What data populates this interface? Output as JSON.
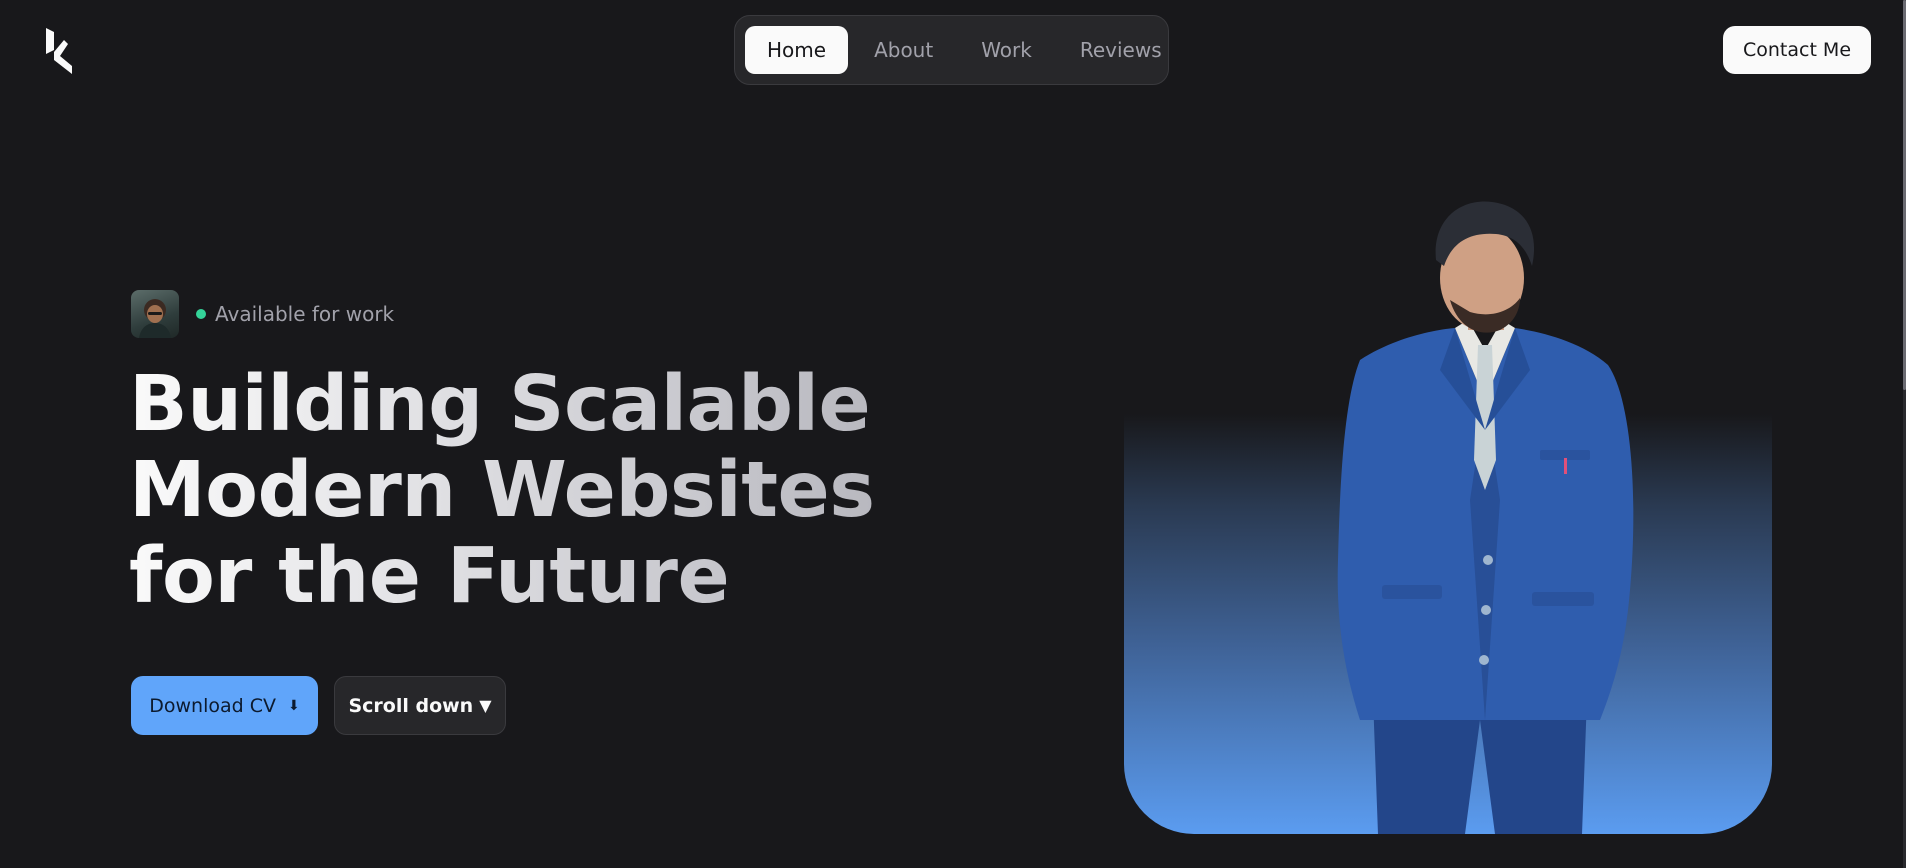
{
  "header": {
    "logo_icon": "brand-logo-icon",
    "nav": [
      {
        "label": "Home",
        "active": true
      },
      {
        "label": "About",
        "active": false
      },
      {
        "label": "Work",
        "active": false
      },
      {
        "label": "Reviews",
        "active": false
      }
    ],
    "contact_label": "Contact Me"
  },
  "hero": {
    "status_text": "Available for work",
    "status_color": "#34d399",
    "headline": [
      "Building Scalable",
      "Modern Websites",
      "for the Future"
    ],
    "download_label": "Download CV",
    "download_icon": "⬇",
    "scroll_label": "Scroll down",
    "scroll_icon": "▼"
  },
  "colors": {
    "background": "#18181b",
    "accent": "#60a5fa",
    "surface": "#27272a"
  }
}
